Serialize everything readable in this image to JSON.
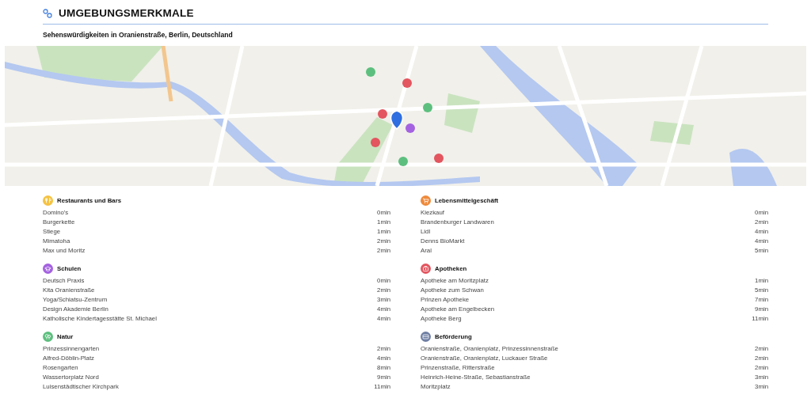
{
  "header": {
    "title": "UMGEBUNGSMERKMALE",
    "subtitle": "Sehenswürdigkeiten in Oranienstraße, Berlin, Deutschland"
  },
  "categories": [
    {
      "title": "Restaurants und Bars",
      "kind": "restaurant",
      "color": "#f5c242",
      "items": [
        {
          "name": "Domino's",
          "time": "0min"
        },
        {
          "name": "Burgerkette",
          "time": "1min"
        },
        {
          "name": "Stiege",
          "time": "1min"
        },
        {
          "name": "Mimatoha",
          "time": "2min"
        },
        {
          "name": "Max und Moritz",
          "time": "2min"
        }
      ]
    },
    {
      "title": "Lebensmittelgeschäft",
      "kind": "grocery",
      "color": "#ef8a3c",
      "items": [
        {
          "name": "Kiezkauf",
          "time": "0min"
        },
        {
          "name": "Brandenburger Landwaren",
          "time": "2min"
        },
        {
          "name": "Lidl",
          "time": "4min"
        },
        {
          "name": "Denns BioMarkt",
          "time": "4min"
        },
        {
          "name": "Aral",
          "time": "5min"
        }
      ]
    },
    {
      "title": "Schulen",
      "kind": "school",
      "color": "#a462e0",
      "items": [
        {
          "name": "Deutsch Praxis",
          "time": "0min"
        },
        {
          "name": "Kita Oranienstraße",
          "time": "2min"
        },
        {
          "name": "Yoga/Schiatsu-Zentrum",
          "time": "3min"
        },
        {
          "name": "Design Akademie Berlin",
          "time": "4min"
        },
        {
          "name": "Katholische Kindertagesstätte St. Michael",
          "time": "4min"
        }
      ]
    },
    {
      "title": "Apotheken",
      "kind": "pharmacy",
      "color": "#e3555f",
      "items": [
        {
          "name": "Apotheke am Moritzplatz",
          "time": "1min"
        },
        {
          "name": "Apotheke zum Schwan",
          "time": "5min"
        },
        {
          "name": "Prinzen Apotheke",
          "time": "7min"
        },
        {
          "name": "Apotheke am Engelbecken",
          "time": "9min"
        },
        {
          "name": "Apotheke Berg",
          "time": "11min"
        }
      ]
    },
    {
      "title": "Natur",
      "kind": "nature",
      "color": "#5dbf7e",
      "items": [
        {
          "name": "Prinzessinnengarten",
          "time": "2min"
        },
        {
          "name": "Alfred-Döblin-Platz",
          "time": "4min"
        },
        {
          "name": "Rosengarten",
          "time": "8min"
        },
        {
          "name": "Wassertorplatz Nord",
          "time": "9min"
        },
        {
          "name": "Luisenstädtischer Kirchpark",
          "time": "11min"
        }
      ]
    },
    {
      "title": "Beförderung",
      "kind": "transport",
      "color": "#6f7fa3",
      "items": [
        {
          "name": "Oranienstraße, Oranienplatz, Prinzessinnenstraße",
          "time": "2min"
        },
        {
          "name": "Oranienstraße, Oranienplatz, Luckauer Straße",
          "time": "2min"
        },
        {
          "name": "Prinzenstraße, Ritterstraße",
          "time": "2min"
        },
        {
          "name": "Heinrich-Heine-Straße, Sebastianstraße",
          "time": "3min"
        },
        {
          "name": "Moritzplatz",
          "time": "3min"
        }
      ]
    }
  ]
}
